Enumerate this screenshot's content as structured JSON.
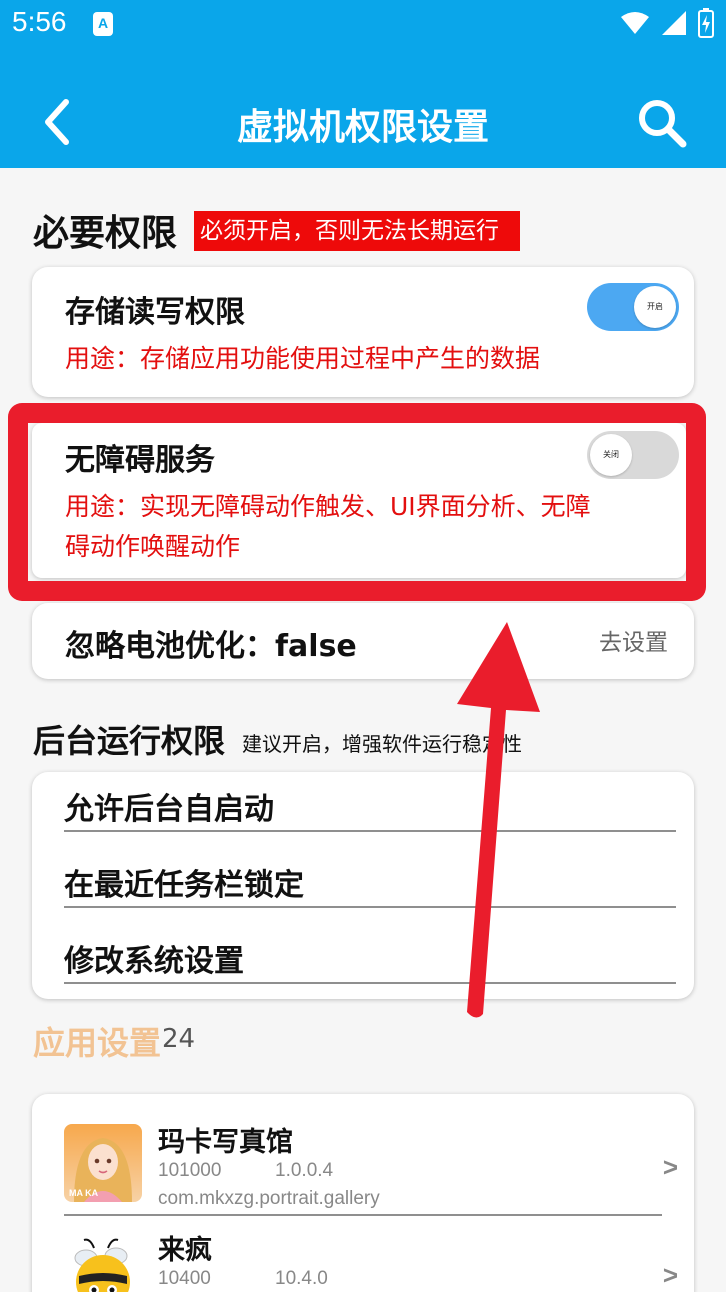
{
  "status": {
    "time": "5:56",
    "app_badge": "A"
  },
  "header": {
    "title": "虚拟机权限设置"
  },
  "required": {
    "title": "必要权限",
    "badge": "必须开启，否则无法长期运行",
    "storage": {
      "title": "存储读写权限",
      "desc": "用途：存储应用功能使用过程中产生的数据",
      "toggle_label": "开启",
      "on": true
    },
    "accessibility": {
      "title": "无障碍服务",
      "desc_line1": "用途：实现无障碍动作触发、UI界面分析、无障",
      "desc_line2": "碍动作唤醒动作",
      "toggle_label": "关闭",
      "on": false
    },
    "battery": {
      "title": "忽略电池优化：false",
      "action": "去设置"
    }
  },
  "background": {
    "title": "后台运行权限",
    "subtitle": "建议开启，增强软件运行稳定性",
    "items": [
      "允许后台自启动",
      "在最近任务栏锁定",
      "修改系统设置"
    ]
  },
  "apps": {
    "title": "应用设置",
    "count": "24",
    "list": [
      {
        "name": "玛卡写真馆",
        "code": "101000",
        "version": "1.0.0.4",
        "package": "com.mkxzg.portrait.gallery",
        "icon_text": "MA KA"
      },
      {
        "name": "来疯",
        "code": "10400",
        "version": "10.4.0",
        "package": ""
      }
    ],
    "chevron": ">"
  },
  "colors": {
    "accent": "#0aa6ea",
    "warning": "#ee0a0a",
    "highlight": "#ea1d2c",
    "toggle_on": "#4ca8f2",
    "section_apps": "#f2c393"
  }
}
